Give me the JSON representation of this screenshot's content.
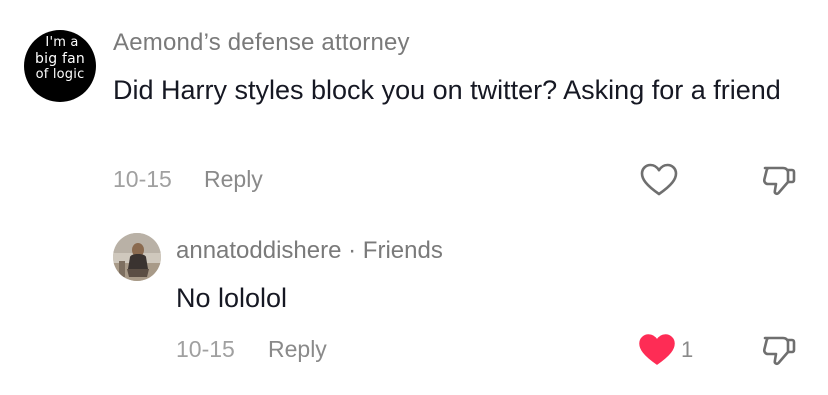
{
  "comment": {
    "avatar_text": [
      "I'm a",
      "big fan",
      "of logic"
    ],
    "username": "Aemond’s defense attorney",
    "text": "Did Harry styles block you on twitter? Asking for a friend",
    "date": "10-15",
    "reply_label": "Reply",
    "liked": false,
    "like_icon": "heart-outline-icon",
    "dislike_icon": "thumbs-down-icon"
  },
  "reply": {
    "username": "annatoddishere · Friends",
    "text": "No lololol",
    "date": "10-15",
    "reply_label": "Reply",
    "liked": true,
    "like_count": "1",
    "like_icon": "heart-filled-icon",
    "dislike_icon": "thumbs-down-icon"
  },
  "colors": {
    "text_primary": "#161823",
    "text_secondary": "#7a7a7a",
    "text_muted": "#a0a0a0",
    "liked_heart": "#fe2c55",
    "icon_outline": "#6f6f6f"
  }
}
